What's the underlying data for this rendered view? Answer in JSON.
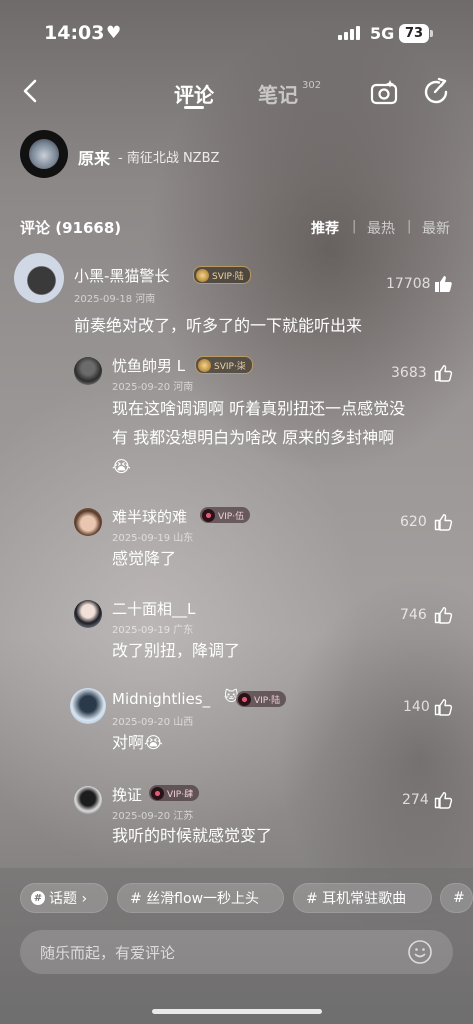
{
  "status_bar": {
    "time": "14:03",
    "network": "5G",
    "battery": "73"
  },
  "header": {
    "tabs": [
      {
        "label": "评论"
      },
      {
        "label": "笔记",
        "count": "302"
      }
    ]
  },
  "song": {
    "title": "原来",
    "artist": "- 南征北战 NZBZ"
  },
  "comments_header": {
    "count_label": "评论 (91668)",
    "sort_options": [
      "推荐",
      "最热",
      "最新"
    ]
  },
  "comments": [
    {
      "name": "小黑-黑猫警长",
      "badge": "SVIP·陆",
      "date": "2025-09-18 河南",
      "likes": "17708",
      "text": "前奏绝对改了，听多了的一下就能听出来",
      "replies": [
        {
          "name": "忧鱼帥男 L",
          "badge": "SVIP·柒",
          "date": "2025-09-20 河南",
          "likes": "3683",
          "text_lines": [
            "现在这啥调调啊 听着真别扭还一点感觉没",
            "有 我都没想明白为啥改 原来的多封神啊",
            "😭"
          ]
        },
        {
          "name": "难半球的难",
          "badge": "VIP·伍",
          "date": "2025-09-19 山东",
          "likes": "620",
          "text_lines": [
            "感觉降了"
          ]
        },
        {
          "name": "二十面相__L",
          "badge": "",
          "date": "2025-09-19 广东",
          "likes": "746",
          "text_lines": [
            "改了别扭，降调了"
          ]
        },
        {
          "name": "Midnightlies_",
          "badge": "VIP·陆",
          "date": "2025-09-20 山西",
          "likes": "140",
          "text_lines": [
            "对啊😭"
          ]
        },
        {
          "name": "挽证",
          "badge": "VIP·肆",
          "date": "2025-09-20 江苏",
          "likes": "274",
          "text_lines": [
            "我听的时候就感觉变了"
          ]
        }
      ]
    }
  ],
  "topic_chips": [
    "话题 ›",
    "# 丝滑flow一秒上头",
    "# 耳机常驻歌曲",
    "#"
  ],
  "input": {
    "placeholder": "随乐而起，有爱评论"
  },
  "icons": {
    "back": "chevron-left-icon",
    "camera": "camera-icon",
    "share": "share-icon",
    "like": "thumbs-up-icon",
    "emoji": "emoji-icon"
  }
}
